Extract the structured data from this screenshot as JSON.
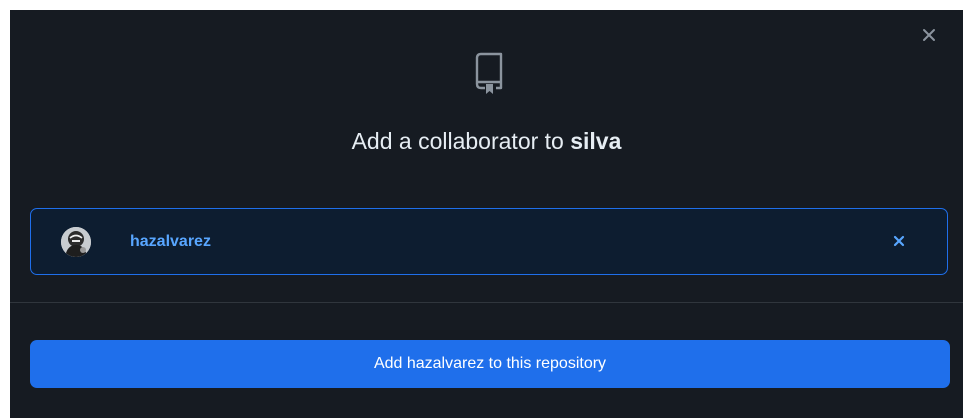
{
  "dialog": {
    "title_prefix": "Add a collaborator to ",
    "repo_name": "silva",
    "icons": {
      "close": "close-icon",
      "repo": "repo-icon",
      "remove": "remove-icon"
    }
  },
  "selected_user": {
    "username": "hazalvarez"
  },
  "footer": {
    "add_button_label": "Add hazalvarez to this repository"
  },
  "colors": {
    "dialog_bg": "#161b22",
    "accent": "#1f6feb",
    "link": "#58a6ff",
    "text": "#e6edf3",
    "muted": "#8b949e"
  }
}
